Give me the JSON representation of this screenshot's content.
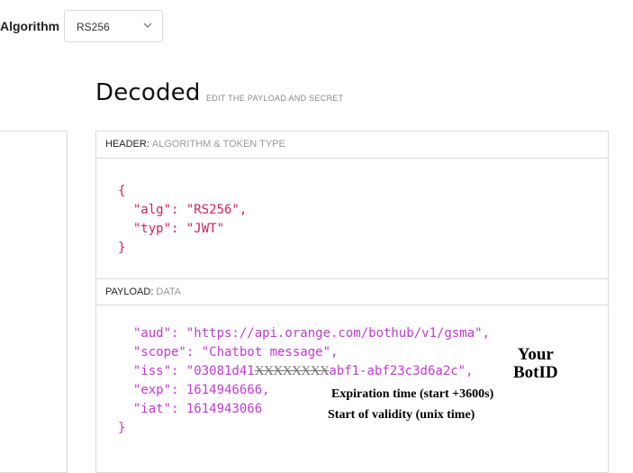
{
  "toolbar": {
    "algorithm_label": "Algorithm",
    "algorithm_value": "RS256"
  },
  "decoded": {
    "title": "Decoded",
    "subtitle": "EDIT THE PAYLOAD AND SECRET"
  },
  "header_section": {
    "label": "HEADER:",
    "sublabel": "ALGORITHM & TOKEN TYPE",
    "lines": [
      "{",
      "  \"alg\": \"RS256\",",
      "  \"typ\": \"JWT\"",
      "}"
    ]
  },
  "payload_section": {
    "label": "PAYLOAD:",
    "sublabel": "DATA",
    "line_aud": "  \"aud\": \"https://api.orange.com/bothub/v1/gsma\",",
    "line_scope": "  \"scope\": \"Chatbot message\",",
    "line_iss_a": "  \"iss\": \"03081d41",
    "line_iss_redacted": "XXXXXXXX",
    "line_iss_b": "abf1-abf23c3d6a2c\",",
    "line_exp": "  \"exp\": 1614946666,",
    "line_iat": "  \"iat\": 1614943066",
    "line_close": "}"
  },
  "annotations": {
    "botid_line1": "Your",
    "botid_line2": "BotID",
    "exp_note": "Expiration time (start +3600s)",
    "iat_note": "Start of validity (unix time)"
  },
  "icons": {
    "select_chevron": "chevron-down-icon"
  }
}
